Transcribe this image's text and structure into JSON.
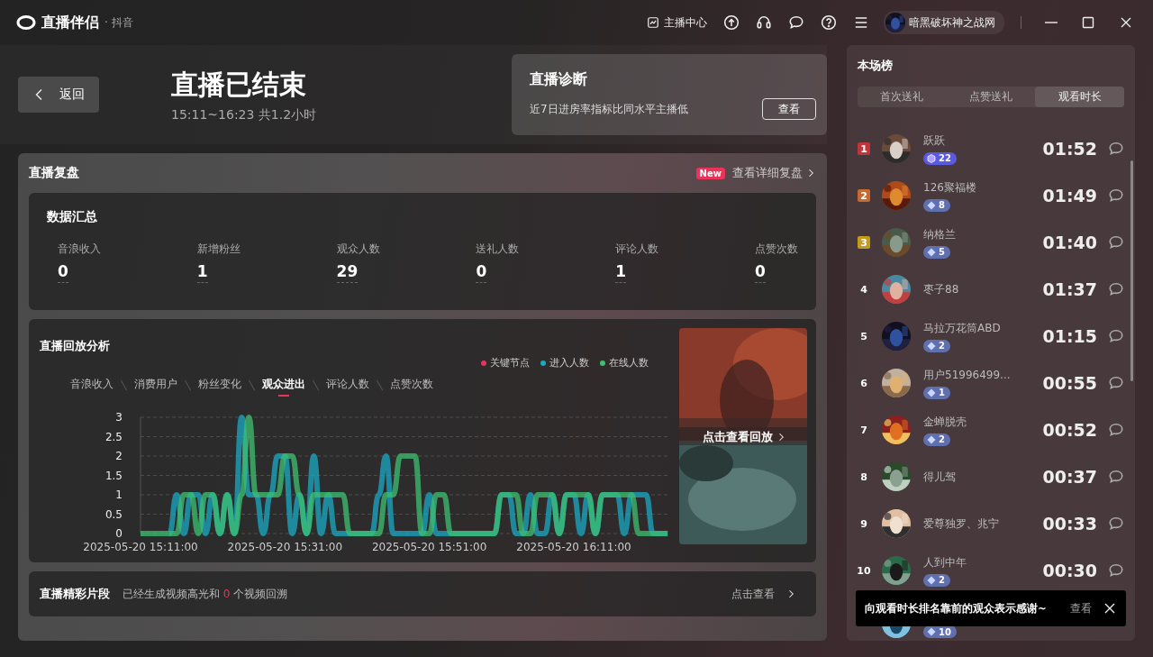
{
  "titlebar": {
    "app_name": "直播伴侣",
    "platform": "· 抖音",
    "anchor_center": "主播中心",
    "username": "暗黑破坏神之战网"
  },
  "header": {
    "title": "直播已结束",
    "time_range": "15:11~16:23 共1.2小时",
    "back_button": "返回"
  },
  "diagnosis": {
    "title": "直播诊断",
    "text": "近7日进房率指标比同水平主播低",
    "button": "查看"
  },
  "review": {
    "title": "直播复盘",
    "badge": "New",
    "link": "查看详细复盘",
    "summary": {
      "title": "数据汇总",
      "metrics": [
        {
          "label": "音浪收入",
          "value": "0"
        },
        {
          "label": "新增粉丝",
          "value": "1"
        },
        {
          "label": "观众人数",
          "value": "29"
        },
        {
          "label": "送礼人数",
          "value": "0"
        },
        {
          "label": "评论人数",
          "value": "1"
        },
        {
          "label": "点赞次数",
          "value": "0"
        }
      ]
    },
    "analysis": {
      "title": "直播回放分析",
      "key_node": {
        "label": "关键节点",
        "color": "#e8335a"
      },
      "tabs": [
        {
          "label": "音浪收入",
          "selected": false
        },
        {
          "label": "消费用户",
          "selected": false
        },
        {
          "label": "粉丝变化",
          "selected": false
        },
        {
          "label": "观众进出",
          "selected": true
        },
        {
          "label": "评论人数",
          "selected": false
        },
        {
          "label": "点赞次数",
          "selected": false
        }
      ],
      "chart_data": {
        "type": "line",
        "categories": [
          "2025-05-20 15:11:00",
          null,
          null,
          null,
          null,
          null,
          null,
          null,
          null,
          null,
          null,
          null,
          null,
          null,
          null,
          null,
          null,
          null,
          null,
          null,
          "2025-05-20 15:31:00",
          null,
          null,
          null,
          null,
          null,
          null,
          null,
          null,
          null,
          null,
          null,
          null,
          null,
          null,
          null,
          null,
          null,
          null,
          null,
          "2025-05-20 15:51:00",
          null,
          null,
          null,
          null,
          null,
          null,
          null,
          null,
          null,
          null,
          null,
          null,
          null,
          null,
          null,
          null,
          null,
          null,
          null,
          "2025-05-20 16:11:00",
          null,
          null,
          null,
          null,
          null,
          null,
          null,
          null,
          null,
          null,
          null,
          null,
          null
        ],
        "ylim": [
          0,
          3
        ],
        "grid": true,
        "yticks": [
          0,
          0.5,
          1,
          1.5,
          2,
          2.5,
          3
        ],
        "series": [
          {
            "name": "进入人数",
            "color": "#1aa9c4",
            "values": [
              null,
              null,
              null,
              null,
              0,
              1,
              0,
              1,
              1,
              0,
              1,
              0,
              1,
              0,
              3,
              1,
              1,
              0,
              1,
              2,
              2,
              0,
              1,
              0,
              2,
              0,
              1,
              0,
              0,
              0,
              0,
              0,
              0,
              1,
              2,
              0,
              0,
              0,
              0,
              0,
              1,
              0,
              0,
              0,
              0,
              0,
              0,
              0,
              0,
              0,
              1,
              1,
              0,
              0,
              1,
              0,
              0,
              1,
              0,
              1,
              1,
              0,
              1,
              0,
              1,
              1,
              1,
              0,
              1,
              1,
              1,
              0,
              0,
              0
            ]
          },
          {
            "name": "在线人数",
            "color": "#3dc070",
            "values": [
              0,
              0,
              0,
              0,
              0,
              0,
              1,
              1,
              0,
              1,
              1,
              0,
              1,
              0,
              1,
              3,
              1,
              1,
              1,
              1,
              2,
              2,
              1,
              0,
              1,
              1,
              1,
              1,
              1,
              0,
              0,
              0,
              0,
              0,
              1,
              1,
              2,
              2,
              2,
              0,
              0,
              1,
              1,
              0,
              0,
              0,
              0,
              0,
              0,
              0,
              1,
              1,
              1,
              0,
              0,
              1,
              1,
              1,
              0,
              1,
              1,
              1,
              1,
              0,
              1,
              1,
              1,
              1,
              1,
              0,
              0,
              0,
              0,
              0
            ]
          }
        ]
      },
      "video": {
        "kind": "picture",
        "label": "点击查看回放"
      }
    },
    "highlights": {
      "title": "直播精彩片段",
      "text_before": "已经生成视频高光和",
      "count": "0",
      "text_after": "个视频回溯",
      "link": "点击查看"
    }
  },
  "leaderboard": {
    "title": "本场榜",
    "tabs": [
      {
        "label": "首次送礼",
        "selected": false
      },
      {
        "label": "点赞送礼",
        "selected": false
      },
      {
        "label": "观看时长",
        "selected": true
      }
    ],
    "rows": [
      {
        "rank": "1",
        "color": "#c0353a",
        "name": "跃跃",
        "badge": {
          "kind": "gem",
          "value": "22"
        },
        "time": "01:52"
      },
      {
        "rank": "2",
        "color": "#c56a30",
        "name": "126聚福楼",
        "badge": {
          "kind": "diamond",
          "value": "8"
        },
        "time": "01:49"
      },
      {
        "rank": "3",
        "color": "#c29a1e",
        "name": "纳格兰",
        "badge": {
          "kind": "diamond",
          "value": "5"
        },
        "time": "01:40"
      },
      {
        "rank": "4",
        "name": "枣子88",
        "time": "01:37"
      },
      {
        "rank": "5",
        "name": "马拉万花筒ABD",
        "badge": {
          "kind": "diamond",
          "value": "2"
        },
        "time": "01:15"
      },
      {
        "rank": "6",
        "name": "用户51996499...",
        "badge": {
          "kind": "diamond",
          "value": "1"
        },
        "time": "00:55"
      },
      {
        "rank": "7",
        "name": "金蝉脱壳",
        "badge": {
          "kind": "diamond",
          "value": "2"
        },
        "time": "00:52"
      },
      {
        "rank": "8",
        "name": "得儿驾",
        "time": "00:37"
      },
      {
        "rank": "9",
        "name": "爱尊独罗、兆宁",
        "time": "00:33"
      },
      {
        "rank": "10",
        "name": "人到中年",
        "badge": {
          "kind": "diamond",
          "value": "2"
        },
        "time": "00:30"
      },
      {
        "badge": {
          "kind": "diamond",
          "value": "10"
        }
      }
    ],
    "toast": {
      "text": "向观看时长排名靠前的观众表示感谢~",
      "button": "查看"
    }
  }
}
